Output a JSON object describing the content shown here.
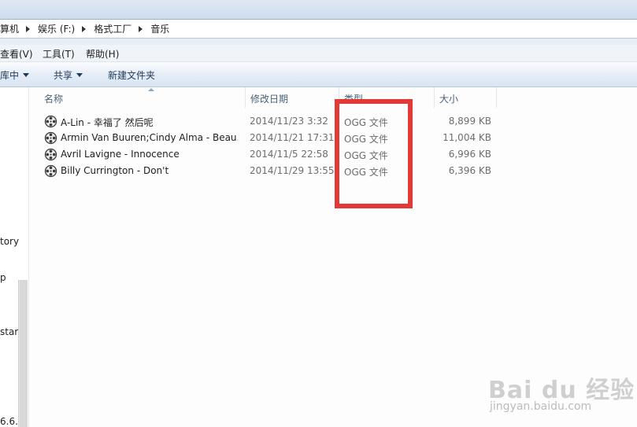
{
  "breadcrumb": {
    "items": [
      "算机",
      "娱乐 (F:)",
      "格式工厂",
      "音乐"
    ]
  },
  "menu": {
    "items": [
      "查看(V)",
      "工具(T)",
      "帮助(H)"
    ]
  },
  "toolbar": {
    "include_library": "库中",
    "share": "共享",
    "new_folder": "新建文件夹"
  },
  "nav": {
    "labels": [
      "tory",
      "p",
      "star",
      "6.6."
    ]
  },
  "columns": {
    "name": "名称",
    "date": "修改日期",
    "type": "类型",
    "size": "大小"
  },
  "files": [
    {
      "name": "A-Lin - 幸福了 然后呢",
      "date": "2014/11/23 3:32",
      "type": "OGG 文件",
      "size": "8,899 KB"
    },
    {
      "name": "Armin Van Buuren;Cindy Alma - Beau...",
      "date": "2014/11/21 17:31",
      "type": "OGG 文件",
      "size": "11,004 KB"
    },
    {
      "name": "Avril Lavigne - Innocence",
      "date": "2014/11/5 22:58",
      "type": "OGG 文件",
      "size": "6,996 KB"
    },
    {
      "name": "Billy Currington - Don't",
      "date": "2014/11/29 13:55",
      "type": "OGG 文件",
      "size": "6,396 KB"
    }
  ],
  "watermark": {
    "logo": "Bai du 经验",
    "url": "jingyan.baidu.com"
  },
  "colors": {
    "highlight": "#e23838",
    "header_text": "#4c607a"
  },
  "icons": {
    "file": "film-reel-icon",
    "breadcrumb_separator": "chevron-right-icon",
    "dropdown": "caret-down-icon"
  }
}
